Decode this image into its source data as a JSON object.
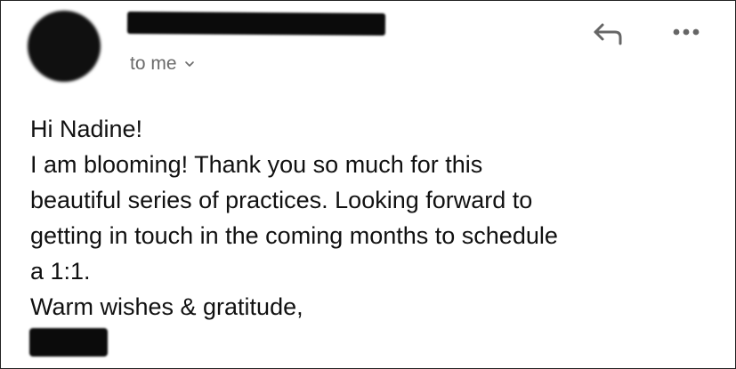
{
  "header": {
    "recipient_label": "to me",
    "icons": {
      "reply": "reply-arrow-icon",
      "more": "more-dots-icon",
      "expand": "chevron-down-icon"
    }
  },
  "message": {
    "lines": [
      "Hi Nadine!",
      "I am blooming! Thank you so much for this",
      "beautiful series of practices. Looking forward to",
      "getting in touch in the coming months to schedule",
      "a 1:1.",
      "Warm wishes & gratitude,"
    ]
  },
  "colors": {
    "text": "#111111",
    "meta_text": "#6b6b6b",
    "icon": "#666666",
    "redaction": "#0b0b0b"
  }
}
